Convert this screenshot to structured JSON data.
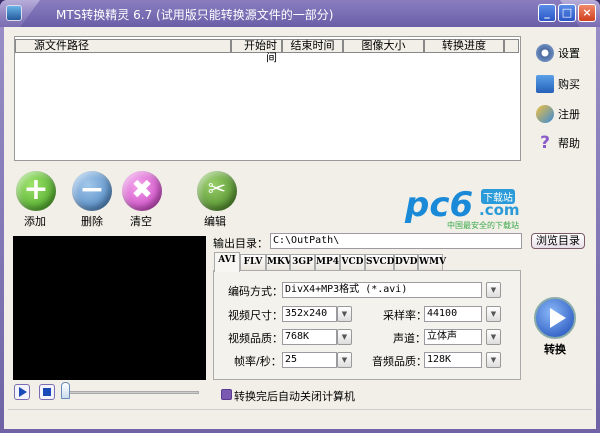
{
  "window": {
    "title": "MTS转换精灵 6.7 (试用版只能转换源文件的一部分)",
    "minimize": "_",
    "maximize": "□",
    "close": "×"
  },
  "file_list": {
    "columns": [
      "源文件路径",
      "开始时间",
      "结束时间",
      "图像大小",
      "转换进度",
      ""
    ]
  },
  "side_menu": [
    {
      "label": "设置",
      "icon": "gear-icon"
    },
    {
      "label": "购买",
      "icon": "cart-icon"
    },
    {
      "label": "注册",
      "icon": "key-icon"
    },
    {
      "label": "帮助",
      "icon": "help-icon"
    }
  ],
  "toolbar": {
    "add": "添加",
    "delete": "删除",
    "clear": "清空",
    "edit": "编辑"
  },
  "logo": {
    "text": "pc6",
    "badge": "下载站",
    "domain": ".com",
    "tagline": "中国最安全的下载站"
  },
  "output": {
    "label": "输出目录：",
    "path": "C:\\OutPath\\",
    "browse": "浏览目录"
  },
  "tabs": [
    "AVI",
    "FLV",
    "MKV",
    "3GP",
    "MP4",
    "VCD",
    "SVCD",
    "DVD",
    "WMV"
  ],
  "settings": {
    "codec_label": "编码方式：",
    "codec": "DivX4+MP3格式 (*.avi)",
    "size_label": "视频尺寸：",
    "size": "352x240",
    "quality_label": "视频品质：",
    "quality": "768K",
    "fps_label": "帧率/秒：",
    "fps": "25",
    "samplerate_label": "采样率：",
    "samplerate": "44100",
    "channel_label": "声道：",
    "channel": "立体声",
    "audio_quality_label": "音频品质：",
    "audio_quality": "128K"
  },
  "convert": {
    "label": "转换"
  },
  "shutdown": {
    "label": "转换完后自动关闭计算机"
  },
  "player": {
    "position": 0
  }
}
